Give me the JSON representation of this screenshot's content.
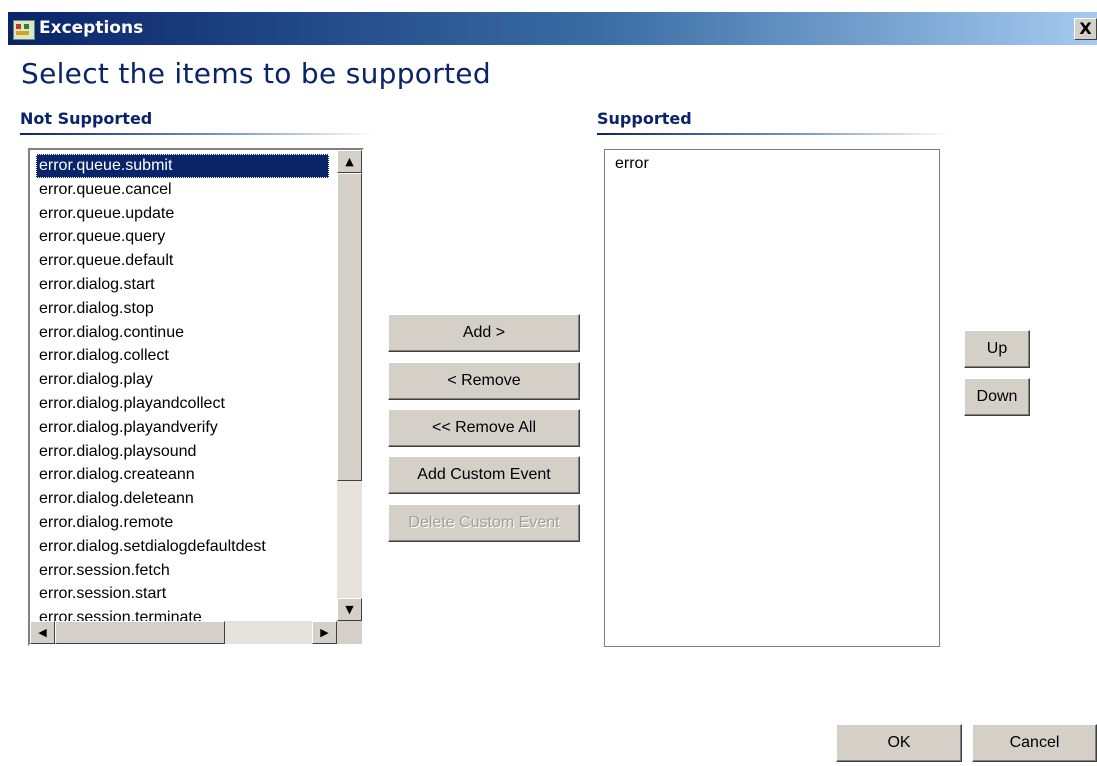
{
  "window": {
    "title": "Exceptions",
    "close_glyph": "X"
  },
  "heading": "Select the items to be supported",
  "not_supported": {
    "label": "Not Supported",
    "items": [
      "error.queue.submit",
      "error.queue.cancel",
      "error.queue.update",
      "error.queue.query",
      "error.queue.default",
      "error.dialog.start",
      "error.dialog.stop",
      "error.dialog.continue",
      "error.dialog.collect",
      "error.dialog.play",
      "error.dialog.playandcollect",
      "error.dialog.playandverify",
      "error.dialog.playsound",
      "error.dialog.createann",
      "error.dialog.deleteann",
      "error.dialog.remote",
      "error.dialog.setdialogdefaultdest",
      "error.session.fetch",
      "error.session.start",
      "error.session.terminate"
    ],
    "selected_index": 0
  },
  "supported": {
    "label": "Supported",
    "items": [
      "error"
    ]
  },
  "buttons": {
    "add": "Add >",
    "remove": "< Remove",
    "remove_all": "<< Remove All",
    "add_custom_event": "Add Custom Event",
    "delete_custom_event": "Delete Custom Event",
    "up": "Up",
    "down": "Down",
    "ok": "OK",
    "cancel": "Cancel"
  },
  "icons": {
    "app": "app-icon",
    "scroll_up": "▲",
    "scroll_down": "▼",
    "scroll_left": "◀",
    "scroll_right": "▶"
  },
  "colors": {
    "title_bar_start": "#0a246a",
    "title_bar_end": "#a6caf0",
    "heading": "#0a246a",
    "selection": "#0a246a",
    "button_face": "#d4d0c8"
  }
}
